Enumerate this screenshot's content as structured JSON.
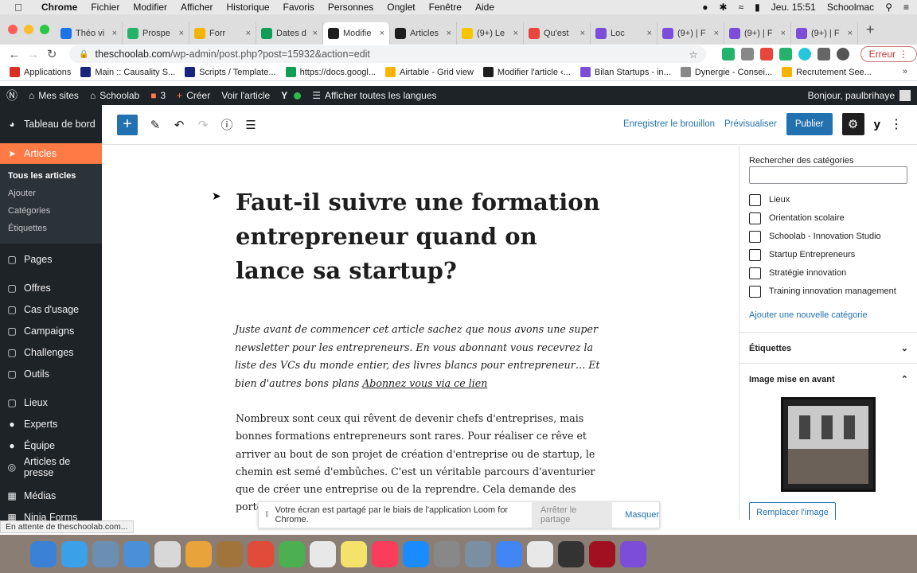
{
  "macos": {
    "app": "Chrome",
    "menus": [
      "Fichier",
      "Modifier",
      "Afficher",
      "Historique",
      "Favoris",
      "Personnes",
      "Onglet",
      "Fenêtre",
      "Aide"
    ],
    "clock": "Jeu. 15:51",
    "user": "Schoolmac"
  },
  "tabs": [
    {
      "label": "Théo vi",
      "color": "#1a73e8"
    },
    {
      "label": "Prospe",
      "color": "#23b36b"
    },
    {
      "label": "Forr",
      "color": "#f4b400"
    },
    {
      "label": "Dates d",
      "color": "#0f9d58"
    },
    {
      "label": "Modifie",
      "color": "#1e1e1e",
      "active": true
    },
    {
      "label": "Articles",
      "color": "#1e1e1e"
    },
    {
      "label": "(9+) Le",
      "color": "#f7c400"
    },
    {
      "label": "Qu'est",
      "color": "#e8453c"
    },
    {
      "label": "Loc",
      "color": "#7b4dd8"
    },
    {
      "label": "(9+) | F",
      "color": "#7b4dd8"
    },
    {
      "label": "(9+) | F",
      "color": "#7b4dd8"
    },
    {
      "label": "(9+) | F",
      "color": "#7b4dd8"
    }
  ],
  "url": {
    "domain": "theschoolab.com",
    "path": "/wp-admin/post.php?post=15932&action=edit",
    "error_label": "Erreur"
  },
  "bookmarks": [
    {
      "label": "Applications",
      "color": "#d93025"
    },
    {
      "label": "Main :: Causality S...",
      "color": "#1a237e"
    },
    {
      "label": "Scripts / Template...",
      "color": "#1a237e"
    },
    {
      "label": "https://docs.googl...",
      "color": "#0f9d58"
    },
    {
      "label": "Airtable - Grid view",
      "color": "#fcb400"
    },
    {
      "label": "Modifier l'article ‹...",
      "color": "#1e1e1e"
    },
    {
      "label": "Bilan Startups - in...",
      "color": "#7b4dd8"
    },
    {
      "label": "Dynergie - Consei...",
      "color": "#888888"
    },
    {
      "label": "Recrutement See...",
      "color": "#f4b400"
    }
  ],
  "wpbar": {
    "my_sites": "Mes sites",
    "site": "Schoolab",
    "comments": "3",
    "new": "Créer",
    "view": "Voir l'article",
    "languages": "Afficher toutes les langues",
    "greeting": "Bonjour, paulbrihaye"
  },
  "sidebar": {
    "dashboard": "Tableau de bord",
    "articles": "Articles",
    "sub": [
      "Tous les articles",
      "Ajouter",
      "Catégories",
      "Étiquettes"
    ],
    "items": [
      "Pages",
      "Offres",
      "Cas d'usage",
      "Campaigns",
      "Challenges",
      "Outils",
      "Lieux",
      "Experts",
      "Équipe",
      "Articles de presse",
      "Médias",
      "Ninja Forms"
    ]
  },
  "toolbar": {
    "save_draft": "Enregistrer le brouillon",
    "preview": "Prévisualiser",
    "publish": "Publier"
  },
  "post": {
    "title": "Faut-il suivre une formation entrepreneur quand on lance sa startup?",
    "intro": "Juste avant de commencer cet article sachez que nous avons une super newsletter pour les entrepreneurs. En vous abonnant vous recevrez la liste des VCs du monde entier, des livres blancs pour entrepreneur… Et bien d'autres bons plans ",
    "intro_link": "Abonnez vous via ce lien",
    "body": "Nombreux sont ceux qui rêvent de devenir chefs d'entreprises, mais bonnes formations entrepreneurs sont rares. Pour réaliser ce rêve et arriver au bout de son projet de création d'entreprise ou de startup, le chemin est semé d'embûches. C'est un véritable parcours d'aventurier que de créer une entreprise ou de la reprendre. Cela demande des porteurs de projet ou repreneurs"
  },
  "panel": {
    "search_label": "Rechercher des catégories",
    "categories": [
      "Lieux",
      "Orientation scolaire",
      "Schoolab - Innovation Studio",
      "Startup Entrepreneurs",
      "Stratégie innovation",
      "Training innovation management"
    ],
    "add_category": "Ajouter une nouvelle catégorie",
    "tags": "Étiquettes",
    "featured_image": "Image mise en avant",
    "replace_image": "Remplacer l'image"
  },
  "loom": {
    "message": "Votre écran est partagé par le biais de l'application Loom for Chrome.",
    "stop": "Arrêter le partage",
    "hide": "Masquer"
  },
  "status": "En attente de theschoolab.com...",
  "dock": [
    "#3b82d6",
    "#3aa0e8",
    "#6b8fb3",
    "#4a90d9",
    "#d8d8d8",
    "#e8a33a",
    "#a0743a",
    "#e04b3a",
    "#4caf50",
    "#e8e8e8",
    "#f5e26b",
    "#fa3d5a",
    "#1a8cff",
    "#888888",
    "#7b8fa3",
    "#4285f4",
    "#e8e8e8",
    "#333333",
    "#a01020",
    "#7b4dd8"
  ]
}
